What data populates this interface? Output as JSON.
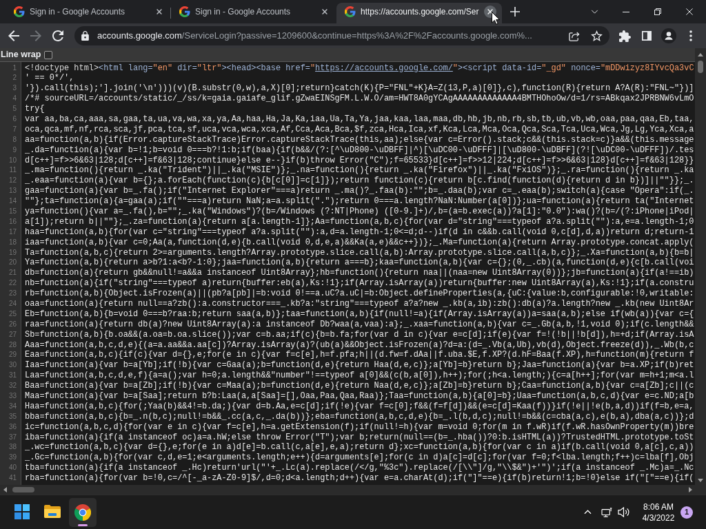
{
  "browser": {
    "tabs": [
      {
        "title": "Sign in - Google Accounts",
        "selected": false,
        "close_hovered": false
      },
      {
        "title": "Sign in - Google Accounts",
        "selected": false,
        "close_hovered": false
      },
      {
        "title": "https://accounts.google.com/Ser",
        "selected": true,
        "close_hovered": true
      }
    ],
    "nav": [
      {
        "kind": "back",
        "disabled": false
      },
      {
        "kind": "forward",
        "disabled": true
      },
      {
        "kind": "reload",
        "disabled": false
      }
    ],
    "address_bar": {
      "host": "accounts.google.com",
      "path": "/ServiceLogin?passive=1209600&continue=https%3A%2F%2Faccounts.google.com%..."
    }
  },
  "view_source": {
    "line_wrap": {
      "label": "Line wrap",
      "checked": false
    },
    "lines": [
      {
        "number": "1",
        "tokens": [
          {
            "kind": "plain",
            "text": "<!doctype html>"
          },
          {
            "kind": "tag",
            "text": "<html lang="
          },
          {
            "kind": "value",
            "text": "\"en\""
          },
          {
            "kind": "tag",
            "text": " dir="
          },
          {
            "kind": "value",
            "text": "\"ltr\""
          },
          {
            "kind": "tag",
            "text": "><head><base href="
          },
          {
            "kind": "value",
            "text": "\""
          },
          {
            "kind": "link",
            "text": "https://accounts.google.com/"
          },
          {
            "kind": "value",
            "text": "\""
          },
          {
            "kind": "tag",
            "text": "><script data-id="
          },
          {
            "kind": "value",
            "text": "\"_gd\""
          },
          {
            "kind": "tag",
            "text": " nonce="
          },
          {
            "kind": "value",
            "text": "\"mDDwizyz8IYvcQa3vC"
          }
        ]
      },
      {
        "number": "2",
        "text": "' == 0*/',"
      },
      {
        "number": "3",
        "text": "'}).call(this);'].join('\\n')))(v)(B.substr(0,w),a,X)[0];return}catch(K){P=\"FNL\"+K}A=Z(13,P,a)[0]},c),function(R){return A?A(R):\"FNL~\"})]"
      },
      {
        "number": "4",
        "text": "/*# sourceURL=/accounts/static/_/ss/k=gaia.gaiafe_glif.gZwaEINSgFM.L.W.O/am=HWT8A0gYCAgAAAAAAAAAAAAA4BMTHOhoOw/d=1/rs=ABkqax2JPRBNW6vLmO"
      },
      {
        "number": "5",
        "text": "try{"
      },
      {
        "number": "6",
        "text": "var aa,ba,ca,aaa,sa,gaa,ta,ua,va,wa,xa,ya,Aa,haa,Ha,Ja,Ka,iaa,Ua,Ta,Ya,jaa,kaa,laa,maa,db,hb,jb,nb,rb,sb,tb,ub,vb,wb,oaa,paa,qaa,Eb,taa,"
      },
      {
        "number": "7",
        "text": "oca,qca,mf,nf,rca,sca,jf,pca,tca,sf,uca,vca,wca,xca,Af,Cca,Aca,Bca,$f,zca,Hca,Ica,xf,Kca,Lca,Mca,Oca,Qca,Sca,Tca,Uca,Wca,Jg,Lg,Yca,Xca,a"
      },
      {
        "number": "8",
        "text": "aa=function(a,b){if(Error.captureStackTrace)Error.captureStackTrace(this,aa);else{var c=Error().stack;c&&(this.stack=c)}a&&(this.message"
      },
      {
        "number": "9",
        "text": "_.da=function(a){var b=!1;b=void 0===b?!1:b;if(baa){if(b&&/(?:[^\\uD800-\\uDBFF]|^)[\\uDC00-\\uDFFF]|[\\uD800-\\uDBFF](?![\\uDC00-\\uDFFF])/.tes"
      },
      {
        "number": "10",
        "text": "d[c++]=f>>6&63|128;d[c++]=f&63|128;continue}else e--}if(b)throw Error(\"C\");f=65533}d[c++]=f>>12|224;d[c++]=f>>6&63|128}d[c++]=f&63|128}}"
      },
      {
        "number": "11",
        "text": "_.ma=function(){return _.ka(\"Trident\")||_.ka(\"MSIE\")};_.na=function(){return _.ka(\"Firefox\")||_.ka(\"FxiOS\")};_.ra=function(){return _.ka"
      },
      {
        "number": "12",
        "text": "_.eaa=function(a){var b={};a.forEach(function(c){b[c[0]]=c[1]});return function(c){return b[c.find(function(d){return d in b})]||\"\"}};_."
      },
      {
        "number": "13",
        "text": "gaa=function(a){var b=_.fa();if(\"Internet Explorer\"===a)return _.ma()?_.faa(b):\"\";b=_.daa(b);var c=_.eaa(b);switch(a){case \"Opera\":if(_."
      },
      {
        "number": "14",
        "text": "\"\"};ta=function(a){a=gaa(a);if(\"\"===a)return NaN;a=a.split(\".\");return 0===a.length?NaN:Number(a[0])};ua=function(a){return ta(\"Internet"
      },
      {
        "number": "15",
        "text": "ya=function(){var a=_.fa(),b=\"\";_.ka(\"Windows\")?(b=/Windows (?:NT|Phone) ([0-9.]+)/,b=(a=b.exec(a))?a[1]:\"0.0\"):wa()?(b=/(?:iPhone|iPod|"
      },
      {
        "number": "16",
        "text": "a[1]);return b||\"\"};_.za=function(a){return a[a.length-1]};Aa=function(a,b,c){for(var d=\"string\"===typeof a?a.split(\"\"):a,e=a.length-1;0"
      },
      {
        "number": "17",
        "text": "haa=function(a,b){for(var c=\"string\"===typeof a?a.split(\"\"):a,d=a.length-1;0<=d;d--)if(d in c&&b.call(void 0,c[d],d,a))return d;return-1"
      },
      {
        "number": "18",
        "text": "iaa=function(a,b){var c=0;Aa(a,function(d,e){b.call(void 0,d,e,a)&&Ka(a,e)&&c++})};_.Ma=function(a){return Array.prototype.concat.apply("
      },
      {
        "number": "19",
        "text": "Ta=function(a,b,c){return 2>=arguments.length?Array.prototype.slice.call(a,b):Array.prototype.slice.call(a,b,c)};_.Xa=function(a,b){b=b|"
      },
      {
        "number": "20",
        "text": "Ya=function(a,b){return a>b?1:a<b?-1:0};jaa=function(a,b){return a===b};kaa=function(a,b){var c={};(0,_.cb)(a,function(d,e){c[b.call(voi"
      },
      {
        "number": "21",
        "text": "db=function(a){return gb&&null!=a&&a instanceof Uint8Array};hb=function(){return naa||(naa=new Uint8Array(0))};jb=function(a){if(a!==ib)"
      },
      {
        "number": "22",
        "text": "nb=function(a){if(\"string\"===typeof a)return{buffer:eb(a),Ks:!1};if(Array.isArray(a))return{buffer:new Uint8Array(a),Ks:!1};if(a.constru"
      },
      {
        "number": "23",
        "text": "rb=function(a,b){Object.isFrozen(a)||(pb?a[pb]|=b:void 0!==a.uC?a.uC|=b:Object.defineProperties(a,{uC:{value:b,configurable:!0,writable:"
      },
      {
        "number": "24",
        "text": "oaa=function(a){return null==a?zb():a.constructor===_.kb?a:\"string\"===typeof a?a?new _.kb(a,ib):zb():db(a)?a.length?new _.kb(new Uint8Ar"
      },
      {
        "number": "25",
        "text": "Eb=function(a,b){b=void 0===b?raa:b;return saa(a,b)};taa=function(a,b){if(null!=a){if(Array.isArray(a))a=saa(a,b);else if(wb(a)){var c={"
      },
      {
        "number": "26",
        "text": "raa=function(a){return db(a)?new Uint8Array(a):a instanceof Db?waa(a,vaa):a};_.xaa=function(a,b){var c=_.Gb(a,b,!1,void 0);if(c.length&&"
      },
      {
        "number": "27",
        "text": "Sb=function(a,b){b.oa&&(a.oa=b.oa.slice());var c=b.aa;if(c){b=b.fa;for(var d in c){var e=c[d];if(e){var f=!(!b||!b[d]),h=+d;if(Array.isA"
      },
      {
        "number": "28",
        "text": "Aaa=function(a,b,c,d,e){(a=a.aa&&a.aa[c])?Array.isArray(a)?(ub(a)&&Object.isFrozen(a)?d=a:(d=_.Vb(a,Ub),vb(d),Object.freeze(d)),_.Wb(b,c"
      },
      {
        "number": "29",
        "text": "Eaa=function(a,b,c){if(c){var d={},e;for(e in c){var f=c[e],h=f.pfa;h||(d.fw=f.dAa||f.uba.$E,f.XP?(d.hF=Baa(f.XP),h=function(m){return f"
      },
      {
        "number": "30",
        "text": "Iaa=function(a){var b=a[Yb];if(!b){var c=Gaa(a);b=function(d,e){return Haa(d,e,c)};a[Yb]=b}return b};Jaa=function(a){var b=a.XP;if(b)ret"
      },
      {
        "number": "31",
        "text": "Laa=function(a,b,c,d,e,f){a=a();var h=0;a.length&&\"number\"!==typeof a[0]&&(c(b,a[0]),h++);for(;h<a.length;){c=a[h++];for(var m=h+1;m<a.l"
      },
      {
        "number": "32",
        "text": "Baa=function(a){var b=a[Zb];if(!b){var c=Maa(a);b=function(d,e){return Naa(d,e,c)};a[Zb]=b}return b};Caa=function(a,b){var c=a[Zb];c||(c"
      },
      {
        "number": "33",
        "text": "Maa=function(a){var b=a[Saa];return b?b:Laa(a,a[Saa]=[],Oaa,Paa,Qaa,Raa)};Taa=function(a,b){a[0]=b};Uaa=function(a,b,c,d){var e=c.ND;a[b"
      },
      {
        "number": "34",
        "text": "Haa=function(a,b,c){for(;Yaa(b)&&4!=b.da;){var d=b.Aa,e=c[d];if(!e){var f=c[0];f&&(f=f[d])&&(e=c[d]=Kaa(f))}if(!e||!e(b,a,d))if(f=b,e=a,"
      },
      {
        "number": "35",
        "text": "bba=function(a,b,c){b=_.n(b,c);null!=b&&_.cc(a,c,_.da(b))};eba=function(a,b,c,d,e){b=_.l(b,d,c);null!=b&&(c=cba(a,c),e(b,a),dba(a,c))};d"
      },
      {
        "number": "36",
        "text": "ic=function(a,b,c,d){for(var e in c){var f=c[e],h=a.getExtension(f);if(null!=h){var m=void 0;for(m in f.wR)if(f.wR.hasOwnProperty(m))bre"
      },
      {
        "number": "37",
        "text": "iba=function(a){if(a instanceof oc)a=a.hW;else throw Error(\"T\");var b;return(null==(b=_.hba())?0:b.isHTML(a))?TrustedHTML.prototype.toSt"
      },
      {
        "number": "38",
        "text": "_.wc=function(a,b,c){var d={},e;for(e in a)d[e]=b.call(c,a[e],e,a);return d};xc=function(a,b){for(var c in a)if(b.call(void 0,a[c],c,a))"
      },
      {
        "number": "39",
        "text": "_.Gc=function(a,b){for(var c,d,e=1;e<arguments.length;e++){d=arguments[e];for(c in d)a[c]=d[c];for(var f=0;f<lba.length;f++)c=lba[f],Obj"
      },
      {
        "number": "40",
        "text": "tba=function(a){if(a instanceof _.Hc)return'url(\"'+_.Lc(a).replace(/</g,\"%3c\").replace(/[\\\\\"]/g,\"\\\\$&\")+'\")';if(a instanceof _.Mc)a=_.Nc"
      },
      {
        "number": "41",
        "text": "rba=function(a){for(var b=!0,c=/^[-_a-zA-Z0-9]$/,d=0;d<a.length;d++){var e=a.charAt(d);if(\"]\"==e){if(b)return!1;b=!0}else if(\"[\"==e){if("
      }
    ]
  },
  "taskbar": {
    "apps": [
      {
        "kind": "start",
        "active": false
      },
      {
        "kind": "folder",
        "active": false
      },
      {
        "kind": "browser",
        "active": true
      }
    ],
    "time": "8:06 AM",
    "date": "4/3/2022",
    "notifications": "1"
  }
}
